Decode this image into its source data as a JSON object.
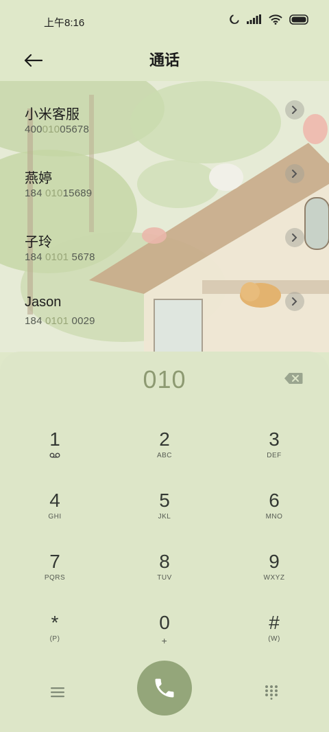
{
  "status": {
    "time": "上午8:16"
  },
  "header": {
    "title": "通话"
  },
  "contacts": [
    {
      "name": "小米客服",
      "number_pre": "400",
      "number_match": "010",
      "number_post": "05678"
    },
    {
      "name": "燕婷",
      "number_pre": "184 ",
      "number_match": "010",
      "number_post": "15689"
    },
    {
      "name": "子玲",
      "number_pre": "184 ",
      "number_match": "0101",
      "number_post": " 5678"
    },
    {
      "name": "Jason",
      "number_pre": "184 ",
      "number_match": "0101",
      "number_post": " 0029"
    }
  ],
  "dialer": {
    "input": "010",
    "keys": [
      {
        "digit": "1",
        "letters": ""
      },
      {
        "digit": "2",
        "letters": "ABC"
      },
      {
        "digit": "3",
        "letters": "DEF"
      },
      {
        "digit": "4",
        "letters": "GHI"
      },
      {
        "digit": "5",
        "letters": "JKL"
      },
      {
        "digit": "6",
        "letters": "MNO"
      },
      {
        "digit": "7",
        "letters": "PQRS"
      },
      {
        "digit": "8",
        "letters": "TUV"
      },
      {
        "digit": "9",
        "letters": "WXYZ"
      },
      {
        "digit": "*",
        "letters": "(P)"
      },
      {
        "digit": "0",
        "letters": "+"
      },
      {
        "digit": "#",
        "letters": "(W)"
      }
    ]
  },
  "icons": {
    "back": "arrow-left-icon",
    "backspace": "backspace-icon",
    "menu": "menu-icon",
    "call": "phone-icon",
    "keypad": "dialpad-icon",
    "voicemail": "voicemail-icon"
  },
  "colors": {
    "accent": "#94a67a",
    "background": "#dfe8c9",
    "digits_highlight": "#98a678"
  }
}
